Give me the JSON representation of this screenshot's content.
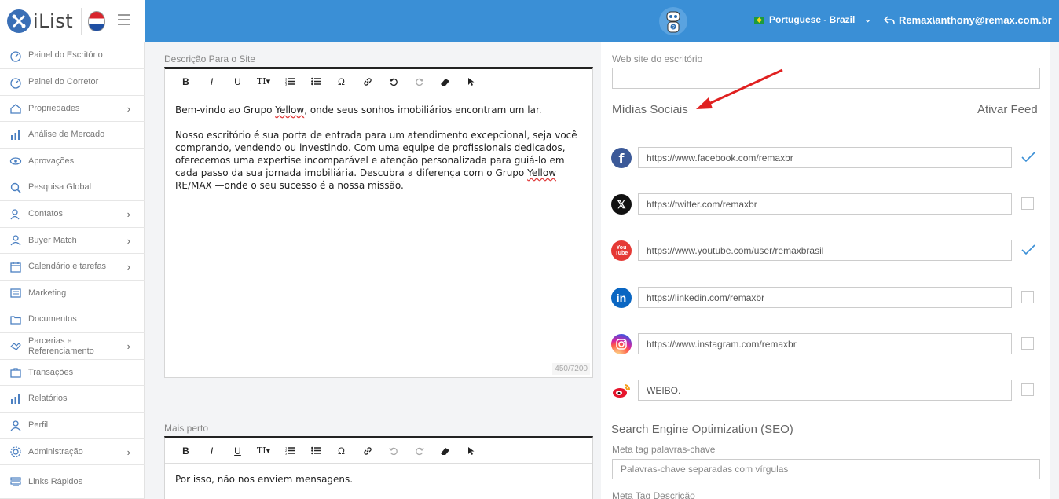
{
  "header": {
    "logo_text": "iList",
    "language": "Portuguese - Brazil",
    "user": "Remax\\anthony@remax.com.br"
  },
  "sidebar": {
    "items": [
      {
        "label": "Painel do Escritório",
        "icon": "dashboard-icon",
        "chevron": ""
      },
      {
        "label": "Painel do Corretor",
        "icon": "dashboard-icon",
        "chevron": ""
      },
      {
        "label": "Propriedades",
        "icon": "home-icon",
        "chevron": "›"
      },
      {
        "label": "Análise de Mercado",
        "icon": "bar-chart-icon",
        "chevron": ""
      },
      {
        "label": "Aprovações",
        "icon": "eye-icon",
        "chevron": ""
      },
      {
        "label": "Pesquisa Global",
        "icon": "search-icon",
        "chevron": ""
      },
      {
        "label": "Contatos",
        "icon": "contacts-icon",
        "chevron": "›"
      },
      {
        "label": "Buyer Match",
        "icon": "user-icon",
        "chevron": "›"
      },
      {
        "label": "Calendário e tarefas",
        "icon": "calendar-icon",
        "chevron": "›"
      },
      {
        "label": "Marketing",
        "icon": "newspaper-icon",
        "chevron": ""
      },
      {
        "label": "Documentos",
        "icon": "folder-icon",
        "chevron": ""
      },
      {
        "label": "Parcerias e Referenciamento",
        "icon": "handshake-icon",
        "chevron": "›"
      },
      {
        "label": "Transações",
        "icon": "briefcase-icon",
        "chevron": ""
      },
      {
        "label": "Relatórios",
        "icon": "bar-chart-icon",
        "chevron": ""
      },
      {
        "label": "Perfil",
        "icon": "user-icon",
        "chevron": ""
      },
      {
        "label": "Administração",
        "icon": "gear-icon",
        "chevron": "›"
      },
      {
        "label": "Links Rápidos",
        "icon": "links-icon",
        "chevron": ""
      }
    ]
  },
  "description_editor": {
    "label": "Descrição Para o Site",
    "paragraph1_a": "Bem-vindo ao Grupo ",
    "paragraph1_b": "Yellow",
    "paragraph1_c": ", onde seus sonhos imobiliários encontram um lar.",
    "paragraph2_a": "Nosso escritório é sua porta de entrada para um atendimento excepcional, seja você comprando, vendendo ou investindo. Com uma equipe de profissionais dedicados, oferecemos uma expertise incomparável e atenção personalizada para guiá-lo em cada passo da sua jornada imobiliária. Descubra a diferença com o Grupo ",
    "paragraph2_b": "Yellow",
    "paragraph2_c": " RE/MAX —onde o seu sucesso é a nossa missão.",
    "counter": "450/7200"
  },
  "closer_editor": {
    "label": "Mais perto",
    "text": "Por isso, não nos enviem mensagens."
  },
  "toolbar": {
    "bold": "B",
    "italic": "I",
    "underline": "U",
    "text_size": "TI▾",
    "omega": "Ω"
  },
  "website": {
    "label": "Web site do escritório",
    "value": ""
  },
  "social": {
    "title": "Mídias Sociais",
    "activate_feed": "Ativar Feed",
    "items": [
      {
        "name": "facebook",
        "value": "https://www.facebook.com/remaxbr",
        "checked": true
      },
      {
        "name": "twitter",
        "value": "https://twitter.com/remaxbr",
        "checked": false
      },
      {
        "name": "youtube",
        "value": "https://www.youtube.com/user/remaxbrasil",
        "checked": true
      },
      {
        "name": "linkedin",
        "value": "https://linkedin.com/remaxbr",
        "checked": false
      },
      {
        "name": "instagram",
        "value": "https://www.instagram.com/remaxbr",
        "checked": false
      },
      {
        "name": "weibo",
        "value": "WEIBO.",
        "checked": false
      }
    ],
    "youtube_icon_text": "You Tube",
    "linkedin_icon_text": "in",
    "twitter_icon_text": "𝕏",
    "facebook_icon_text": "f"
  },
  "seo": {
    "title": "Search Engine Optimization (SEO)",
    "keywords_label": "Meta tag palavras-chave",
    "keywords_placeholder": "Palavras-chave separadas com vírgulas",
    "description_label": "Meta Tag Descrição"
  },
  "colors": {
    "topbar": "#3a8fd6",
    "accent_check": "#3a8fd6",
    "arrow": "#e02020"
  }
}
